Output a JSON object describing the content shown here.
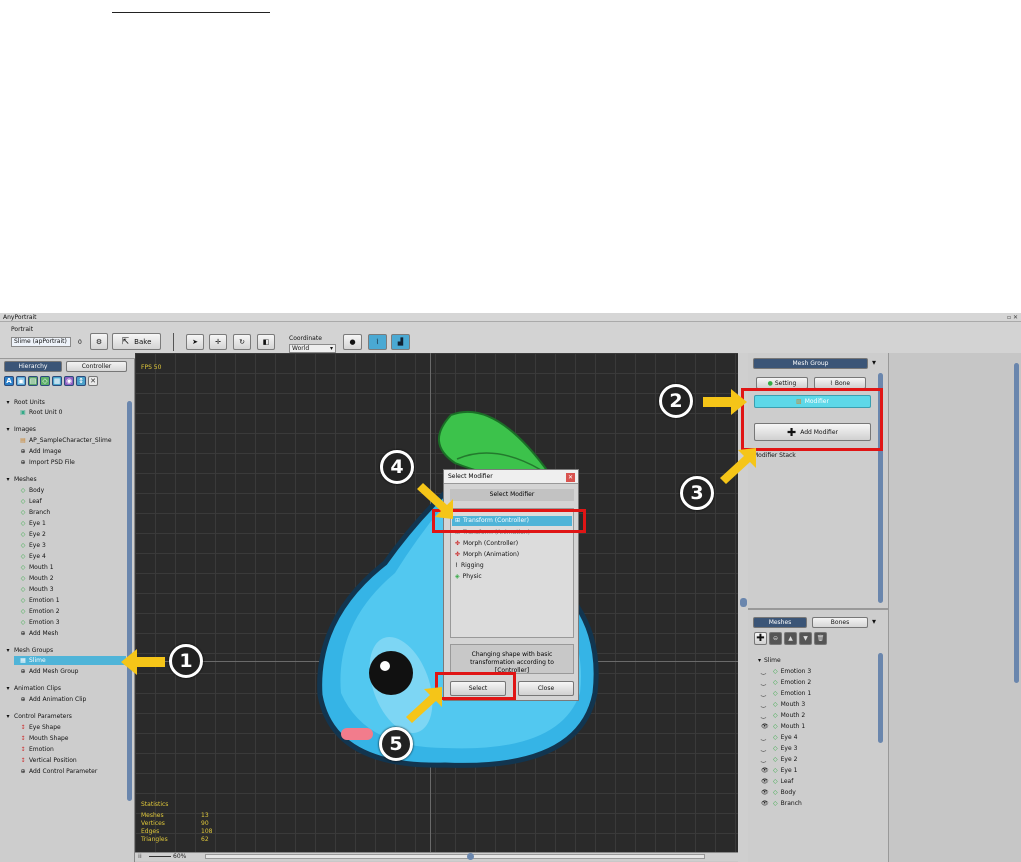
{
  "app_title": "AnyPortrait",
  "toolbar": {
    "portrait_label": "Portrait",
    "portrait_value": "Slime (apPortrait)",
    "portrait_num": "0",
    "bake_label": "Bake",
    "coordinate_label": "Coordinate",
    "coordinate_value": "World"
  },
  "left_panel": {
    "tabs": [
      "Hierarchy",
      "Controller"
    ],
    "sections": {
      "root_units": {
        "title": "Root Units",
        "items": [
          "Root Unit 0"
        ]
      },
      "images": {
        "title": "Images",
        "items": [
          "AP_SampleCharacter_Slime",
          "Add Image",
          "Import PSD File"
        ]
      },
      "meshes": {
        "title": "Meshes",
        "items": [
          "Body",
          "Leaf",
          "Branch",
          "Eye 1",
          "Eye 2",
          "Eye 3",
          "Eye 4",
          "Mouth 1",
          "Mouth 2",
          "Mouth 3",
          "Emotion 1",
          "Emotion 2",
          "Emotion 3",
          "Add Mesh"
        ]
      },
      "mesh_groups": {
        "title": "Mesh Groups",
        "items": [
          "Slime",
          "Add Mesh Group"
        ]
      },
      "animation_clips": {
        "title": "Animation Clips",
        "items": [
          "Add Animation Clip"
        ]
      },
      "control_parameters": {
        "title": "Control Parameters",
        "items": [
          "Eye Shape",
          "Mouth Shape",
          "Emotion",
          "Vertical Position",
          "Add Control Parameter"
        ]
      }
    }
  },
  "canvas": {
    "fps": "FPS 50",
    "statistics_title": "Statistics",
    "stats": [
      {
        "label": "Meshes",
        "value": "13"
      },
      {
        "label": "Vertices",
        "value": "90"
      },
      {
        "label": "Edges",
        "value": "108"
      },
      {
        "label": "Triangles",
        "value": "62"
      }
    ],
    "zoom": "60%"
  },
  "dialog": {
    "title": "Select Modifier",
    "header": "Select Modifier",
    "items": [
      "Transform (Controller)",
      "Transform (Animation)",
      "Morph (Controller)",
      "Morph (Animation)",
      "Rigging",
      "Physic"
    ],
    "description": "Changing shape with basic transformation according to [Controller]",
    "select_label": "Select",
    "close_label": "Close"
  },
  "right_panel": {
    "header_tab": "Mesh Group",
    "setting_label": "Setting",
    "bone_label": "Bone",
    "modifier_label": "Modifier",
    "add_modifier_label": "Add Modifier",
    "modifier_stack_label": "Modifier Stack",
    "lower_tabs": [
      "Meshes",
      "Bones"
    ],
    "mesh_root": "Slime",
    "mesh_items": [
      "Emotion 3",
      "Emotion 2",
      "Emotion 1",
      "Mouth 3",
      "Mouth 2",
      "Mouth 1",
      "Eye 4",
      "Eye 3",
      "Eye 2",
      "Eye 1",
      "Leaf",
      "Body",
      "Branch"
    ]
  },
  "annotations": [
    "1",
    "2",
    "3",
    "4",
    "5"
  ],
  "colors": {
    "highlight": "#4fb4d8",
    "callout_arrow": "#f5c518",
    "callout_box": "#e01515",
    "tab_active": "#3b5577"
  }
}
